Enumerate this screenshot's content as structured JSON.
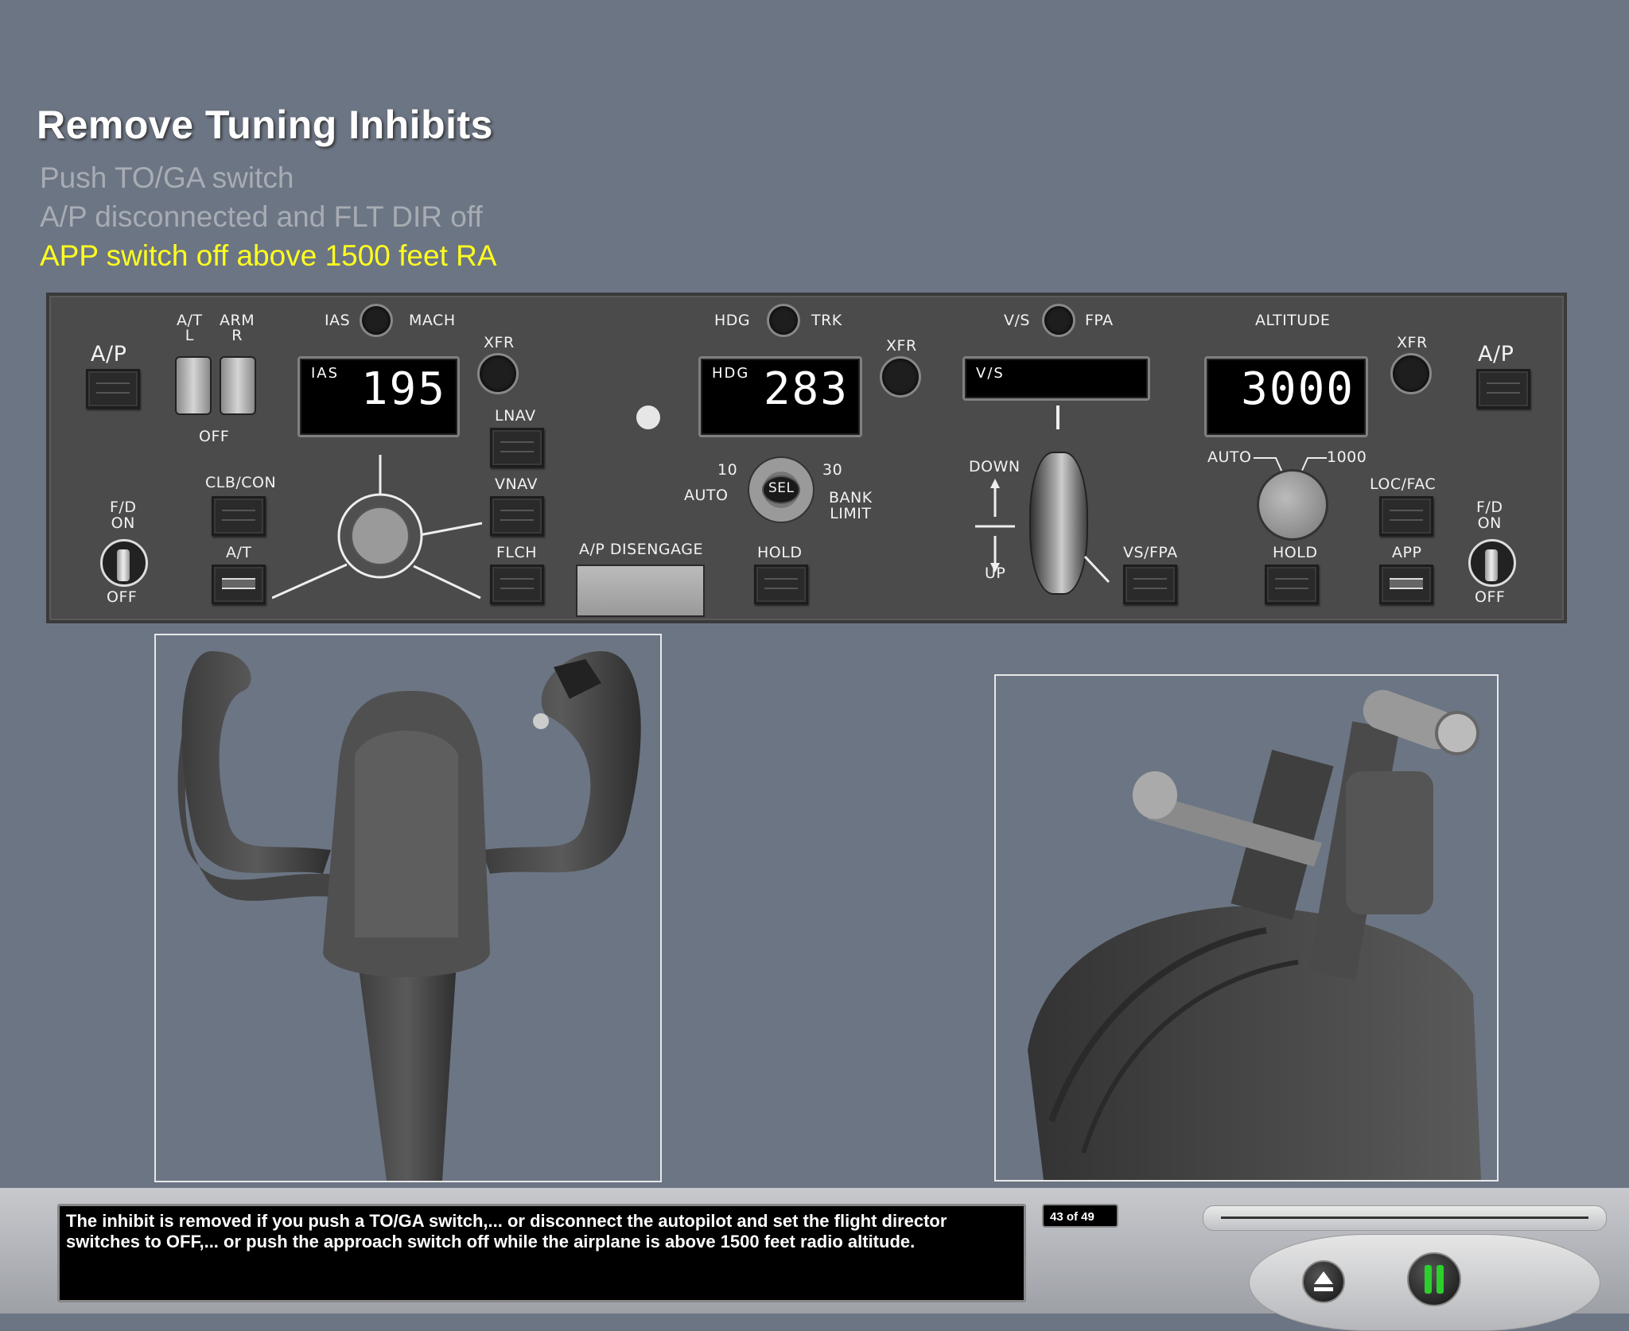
{
  "header": {
    "title": "Remove Tuning Inhibits",
    "steps": [
      "Push TO/GA switch",
      "A/P disconnected and FLT DIR off",
      "APP switch off above 1500 feet RA"
    ]
  },
  "mcp": {
    "ap_left": "A/P",
    "ap_right": "A/P",
    "at_l": "A/T\nL",
    "arm_r": "ARM\nR",
    "off": "OFF",
    "ias_mach_left": "IAS",
    "ias_mach_right": "MACH",
    "xfr": "XFR",
    "ias_display_label": "IAS",
    "ias_value": "195",
    "lnav": "LNAV",
    "vnav": "VNAV",
    "flch": "FLCH",
    "clb_con": "CLB/CON",
    "at": "A/T",
    "fd_on": "F/D\nON",
    "fd_off": "OFF",
    "hdg_trk_left": "HDG",
    "hdg_trk_right": "TRK",
    "hdg_display_label": "HDG",
    "hdg_value": "283",
    "bank_10": "10",
    "bank_30": "30",
    "auto": "AUTO",
    "sel": "SEL",
    "bank_limit": "BANK\nLIMIT",
    "ap_disengage": "A/P DISENGAGE",
    "hold": "HOLD",
    "vs_fpa_left": "V/S",
    "vs_fpa_right": "FPA",
    "vs_display_label": "V/S",
    "down": "DOWN",
    "up": "UP",
    "vs_fpa": "VS/FPA",
    "altitude": "ALTITUDE",
    "alt_value": "3000",
    "alt_auto": "AUTO",
    "alt_1000": "1000",
    "loc_fac": "LOC/FAC",
    "app": "APP"
  },
  "footer": {
    "caption": "The inhibit is removed if you push a TO/GA switch,... or disconnect the autopilot and set the flight director switches to OFF,... or push the approach switch off while the airplane is above 1500 feet radio altitude.",
    "page_counter": "43 of 49",
    "progress": 0.0,
    "eject_icon": "eject-icon",
    "pause_icon": "pause-icon",
    "pause_color": "#2dcf2d"
  }
}
